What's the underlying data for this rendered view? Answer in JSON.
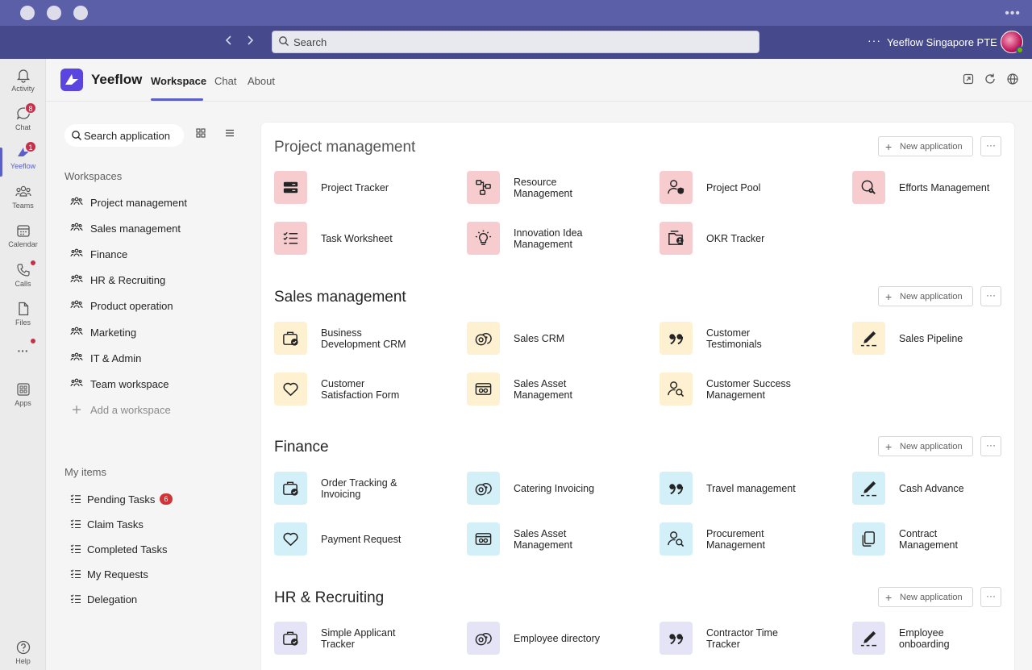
{
  "topbar": {
    "search_placeholder": "Search",
    "more": "···",
    "org_name": "Yeeflow Singapore PTE",
    "title_more": "•••"
  },
  "rail": {
    "items": [
      {
        "label": "Activity",
        "icon": "bell-icon"
      },
      {
        "label": "Chat",
        "icon": "chat-icon",
        "badge": "8"
      },
      {
        "label": "Yeeflow",
        "icon": "yeeflow-icon",
        "badge": "1"
      },
      {
        "label": "Teams",
        "icon": "teams-icon"
      },
      {
        "label": "Calendar",
        "icon": "calendar-icon"
      },
      {
        "label": "Calls",
        "icon": "phone-icon"
      },
      {
        "label": "Files",
        "icon": "file-icon"
      },
      {
        "label": "···",
        "icon": "more-icon"
      },
      {
        "label": "Apps",
        "icon": "apps-icon"
      },
      {
        "label": "Help",
        "icon": "help-icon"
      }
    ]
  },
  "header": {
    "brand": "Yeeflow",
    "tabs": [
      {
        "label": "Workspace"
      },
      {
        "label": "Chat"
      },
      {
        "label": "About"
      }
    ]
  },
  "sidebar": {
    "search_placeholder": "Search application",
    "workspaces_heading": "Workspaces",
    "workspaces": [
      {
        "label": "Project management"
      },
      {
        "label": "Sales management"
      },
      {
        "label": "Finance"
      },
      {
        "label": "HR & Recruiting"
      },
      {
        "label": "Product operation"
      },
      {
        "label": "Marketing"
      },
      {
        "label": "IT & Admin"
      },
      {
        "label": "Team workspace"
      }
    ],
    "add_workspace": "Add a workspace",
    "my_items_heading": "My items",
    "my_items": [
      {
        "label": "Pending Tasks",
        "badge": "6"
      },
      {
        "label": "Claim Tasks"
      },
      {
        "label": "Completed Tasks"
      },
      {
        "label": "My Requests"
      },
      {
        "label": "Delegation"
      }
    ]
  },
  "main": {
    "new_app_label": "New application",
    "more_label": "···",
    "sections": [
      {
        "title": "Project management",
        "color": "#f6cccf",
        "apps": [
          {
            "label": "Project Tracker",
            "icon": "card-icon"
          },
          {
            "label": "Resource Management",
            "icon": "flow-icon"
          },
          {
            "label": "Project Pool",
            "icon": "user-shield-icon"
          },
          {
            "label": "Efforts Management",
            "icon": "search-gear-icon"
          },
          {
            "label": "Task Worksheet",
            "icon": "checklist-icon"
          },
          {
            "label": "Innovation Idea Management",
            "icon": "lightbulb-icon"
          },
          {
            "label": "OKR Tracker",
            "icon": "folder-user-icon"
          }
        ]
      },
      {
        "title": "Sales management",
        "color": "#fdf1d1",
        "apps": [
          {
            "label": "Business Development CRM",
            "icon": "briefcase-check-icon"
          },
          {
            "label": "Sales CRM",
            "icon": "coins-icon"
          },
          {
            "label": "Customer Testimonials",
            "icon": "quote-icon"
          },
          {
            "label": "Sales Pipeline",
            "icon": "pen-sign-icon"
          },
          {
            "label": "Customer Satisfaction Form",
            "icon": "heart-icon"
          },
          {
            "label": "Sales Asset Management",
            "icon": "money-box-icon"
          },
          {
            "label": "Customer Success Management",
            "icon": "user-search-icon"
          }
        ]
      },
      {
        "title": "Finance",
        "color": "#d3f0f9",
        "apps": [
          {
            "label": "Order Tracking & Invoicing",
            "icon": "briefcase-check-icon"
          },
          {
            "label": "Catering Invoicing",
            "icon": "coins-icon"
          },
          {
            "label": "Travel management",
            "icon": "quote-icon"
          },
          {
            "label": "Cash Advance",
            "icon": "pen-sign-icon"
          },
          {
            "label": "Payment Request",
            "icon": "heart-icon"
          },
          {
            "label": "Sales Asset Management",
            "icon": "money-box-icon"
          },
          {
            "label": "Procurement Management",
            "icon": "user-search-icon"
          },
          {
            "label": "Contract Management",
            "icon": "copy-icon"
          }
        ]
      },
      {
        "title": "HR & Recruiting",
        "color": "#e5e4f7",
        "apps": [
          {
            "label": "Simple Applicant Tracker",
            "icon": "briefcase-check-icon"
          },
          {
            "label": "Employee directory",
            "icon": "coins-icon"
          },
          {
            "label": "Contractor Time Tracker",
            "icon": "quote-icon"
          },
          {
            "label": "Employee onboarding",
            "icon": "pen-sign-icon"
          }
        ]
      }
    ]
  }
}
